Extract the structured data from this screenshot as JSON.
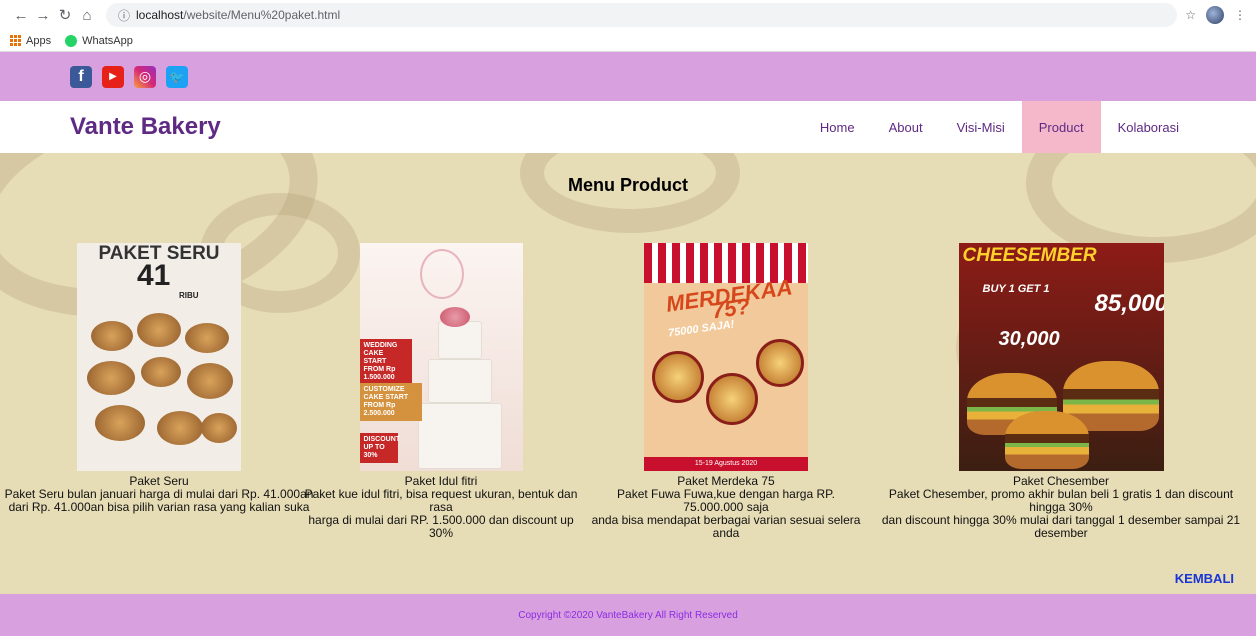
{
  "browser": {
    "url_host": "localhost",
    "url_path": "/website/Menu%20paket.html",
    "bookmarks": [
      "Apps",
      "WhatsApp"
    ]
  },
  "site": {
    "brand": "Vante Bakery",
    "menu": [
      "Home",
      "About",
      "Visi-Misi",
      "Product",
      "Kolaborasi"
    ],
    "active_menu": "Product",
    "social": [
      "facebook-icon",
      "youtube-icon",
      "instagram-icon",
      "twitter-icon"
    ]
  },
  "page": {
    "title": "Menu Product",
    "back_link": "KEMBALI",
    "footer": "Copyright ©2020 VanteBakery All Right Reserved"
  },
  "products": [
    {
      "name": "Paket Seru",
      "desc1": "Paket Seru bulan januari harga di mulai dari Rp. 41.000an",
      "desc2": "dari Rp. 41.000an bisa pilih varian rasa yang kalian suka",
      "poster": {
        "heading": "PAKET SERU",
        "number": "41",
        "suffix": "RIBU"
      }
    },
    {
      "name": "Paket Idul fitri",
      "desc1": "Paket kue idul fitri, bisa request ukuran, bentuk dan rasa",
      "desc2": "harga di mulai dari RP. 1.500.000 dan discount up 30%",
      "poster": {
        "tag1": "WEDDING CAKE START FROM Rp 1.500.000",
        "tag2": "CUSTOMIZE CAKE START FROM Rp 2.500.000",
        "tag3": "DISCOUNT UP TO 30%"
      }
    },
    {
      "name": "Paket Merdeka 75",
      "desc1": "Paket Fuwa Fuwa,kue dengan harga RP. 75.000.000 saja",
      "desc2": "anda bisa mendapat berbagai varian sesuai selera anda",
      "poster": {
        "heading": "MERDEKAA 75?",
        "sub": "75000 SAJA!",
        "date": "15-19 Agustus 2020"
      }
    },
    {
      "name": "Paket Chesember",
      "desc1": "Paket Chesember, promo akhir bulan beli 1 gratis 1 dan discount hingga 30%",
      "desc2": "dan discount hingga 30% mulai dari tanggal 1 desember sampai 21 desember",
      "poster": {
        "heading": "CHEESEMBER",
        "price1": "30,000",
        "price2": "85,000",
        "promo": "BUY 1 GET 1"
      }
    }
  ]
}
